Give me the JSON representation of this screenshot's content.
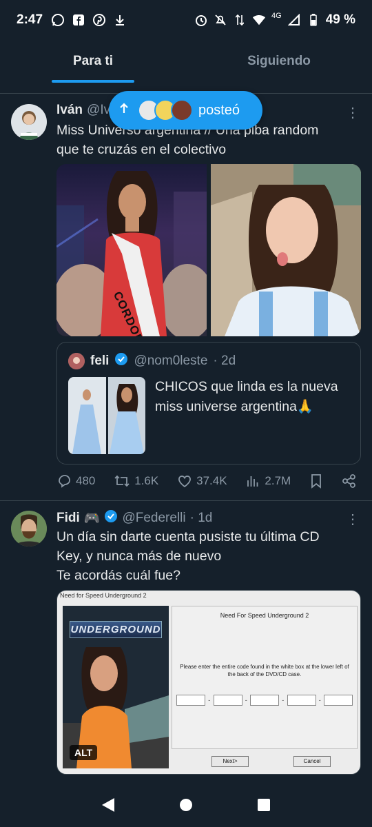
{
  "status_bar": {
    "time": "2:47",
    "network": "4G",
    "battery": "49 %"
  },
  "tabs": [
    {
      "label": "Para ti",
      "active": true
    },
    {
      "label": "Siguiendo",
      "active": false
    }
  ],
  "posted_pill": {
    "label": "posteó"
  },
  "post1": {
    "name": "Iván",
    "handle": "@Iv",
    "text": "Miss Universo argentina // Una piba random\nque te cruzás en el colectivo",
    "image_sash_text": "CORDOBA",
    "quote": {
      "name": "feli",
      "handle": "@nom0leste",
      "time": "· 2d",
      "text": "CHICOS que linda es la nueva miss universe argentina🙏"
    },
    "actions": {
      "replies": "480",
      "reposts": "1.6K",
      "likes": "37.4K",
      "views": "2.7M"
    }
  },
  "post2": {
    "name": "Fidi",
    "name_emoji": "🎮",
    "handle": "@Federelli",
    "time": "· 1d",
    "text": "Un día sin darte cuenta pusiste tu última CD\nKey, y nunca más de nuevo\nTe acordás cuál fue?",
    "image": {
      "window_title": "Need for Speed Underground 2",
      "logo_text": "UNDERGROUND",
      "panel_title": "Need For Speed Underground 2",
      "instructions": "Please enter the entire code found in the white box at the lower left of the back of the DVD/CD case.",
      "next_button": "Next>",
      "cancel_button": "Cancel",
      "alt_badge": "ALT"
    }
  },
  "colors": {
    "background": "#15202b",
    "accent": "#1d9bf0",
    "muted": "#8b98a5",
    "divider": "#38444d"
  }
}
